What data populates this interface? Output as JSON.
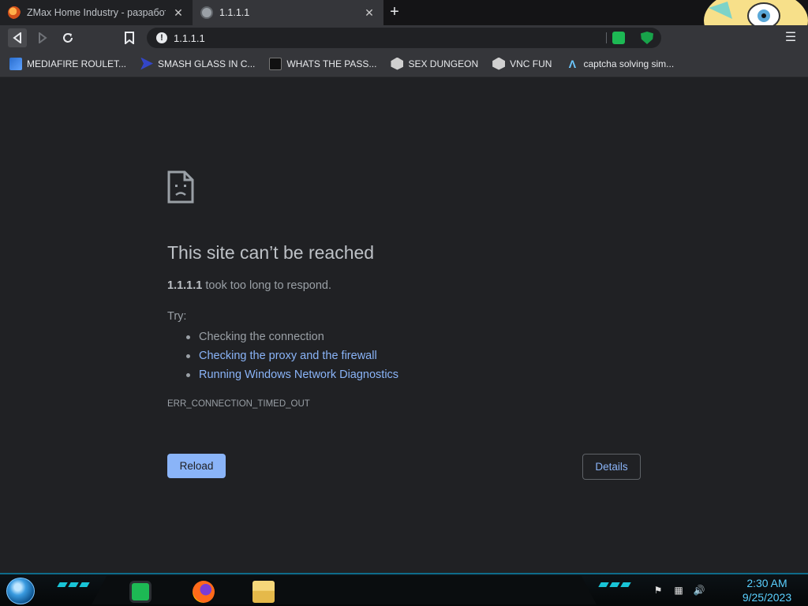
{
  "tabs": [
    {
      "title": "ZMax Home Industry - разработка",
      "close": "✕",
      "icon": "zmax-favicon"
    },
    {
      "title": "1.1.1.1",
      "close": "✕",
      "icon": "globe-favicon"
    }
  ],
  "new_tab": "+",
  "omnibox": {
    "url": "1.1.1.1",
    "security_icon": "!"
  },
  "bookmarks": [
    {
      "label": "MEDIAFIRE ROULET...",
      "icon": "mediafire-icon"
    },
    {
      "label": "SMASH GLASS IN C...",
      "icon": "smash-icon"
    },
    {
      "label": "WHATS THE PASS...",
      "icon": "terminal-icon"
    },
    {
      "label": "SEX DUNGEON",
      "icon": "dungeon-icon"
    },
    {
      "label": "VNC FUN",
      "icon": "vnc-icon"
    },
    {
      "label": "captcha solving sim...",
      "icon": "captcha-icon"
    }
  ],
  "error": {
    "title": "This site can’t be reached",
    "host": "1.1.1.1",
    "desc_suffix": " took too long to respond.",
    "try_label": "Try:",
    "suggestions": [
      "Checking the connection",
      "Checking the proxy and the firewall",
      "Running Windows Network Diagnostics"
    ],
    "code": "ERR_CONNECTION_TIMED_OUT",
    "reload_label": "Reload",
    "details_label": "Details"
  },
  "clock": {
    "time": "2:30 AM",
    "date": "9/25/2023"
  },
  "colors": {
    "link": "#8ab4f8",
    "background": "#202124",
    "clock": "#5ad0ff"
  }
}
